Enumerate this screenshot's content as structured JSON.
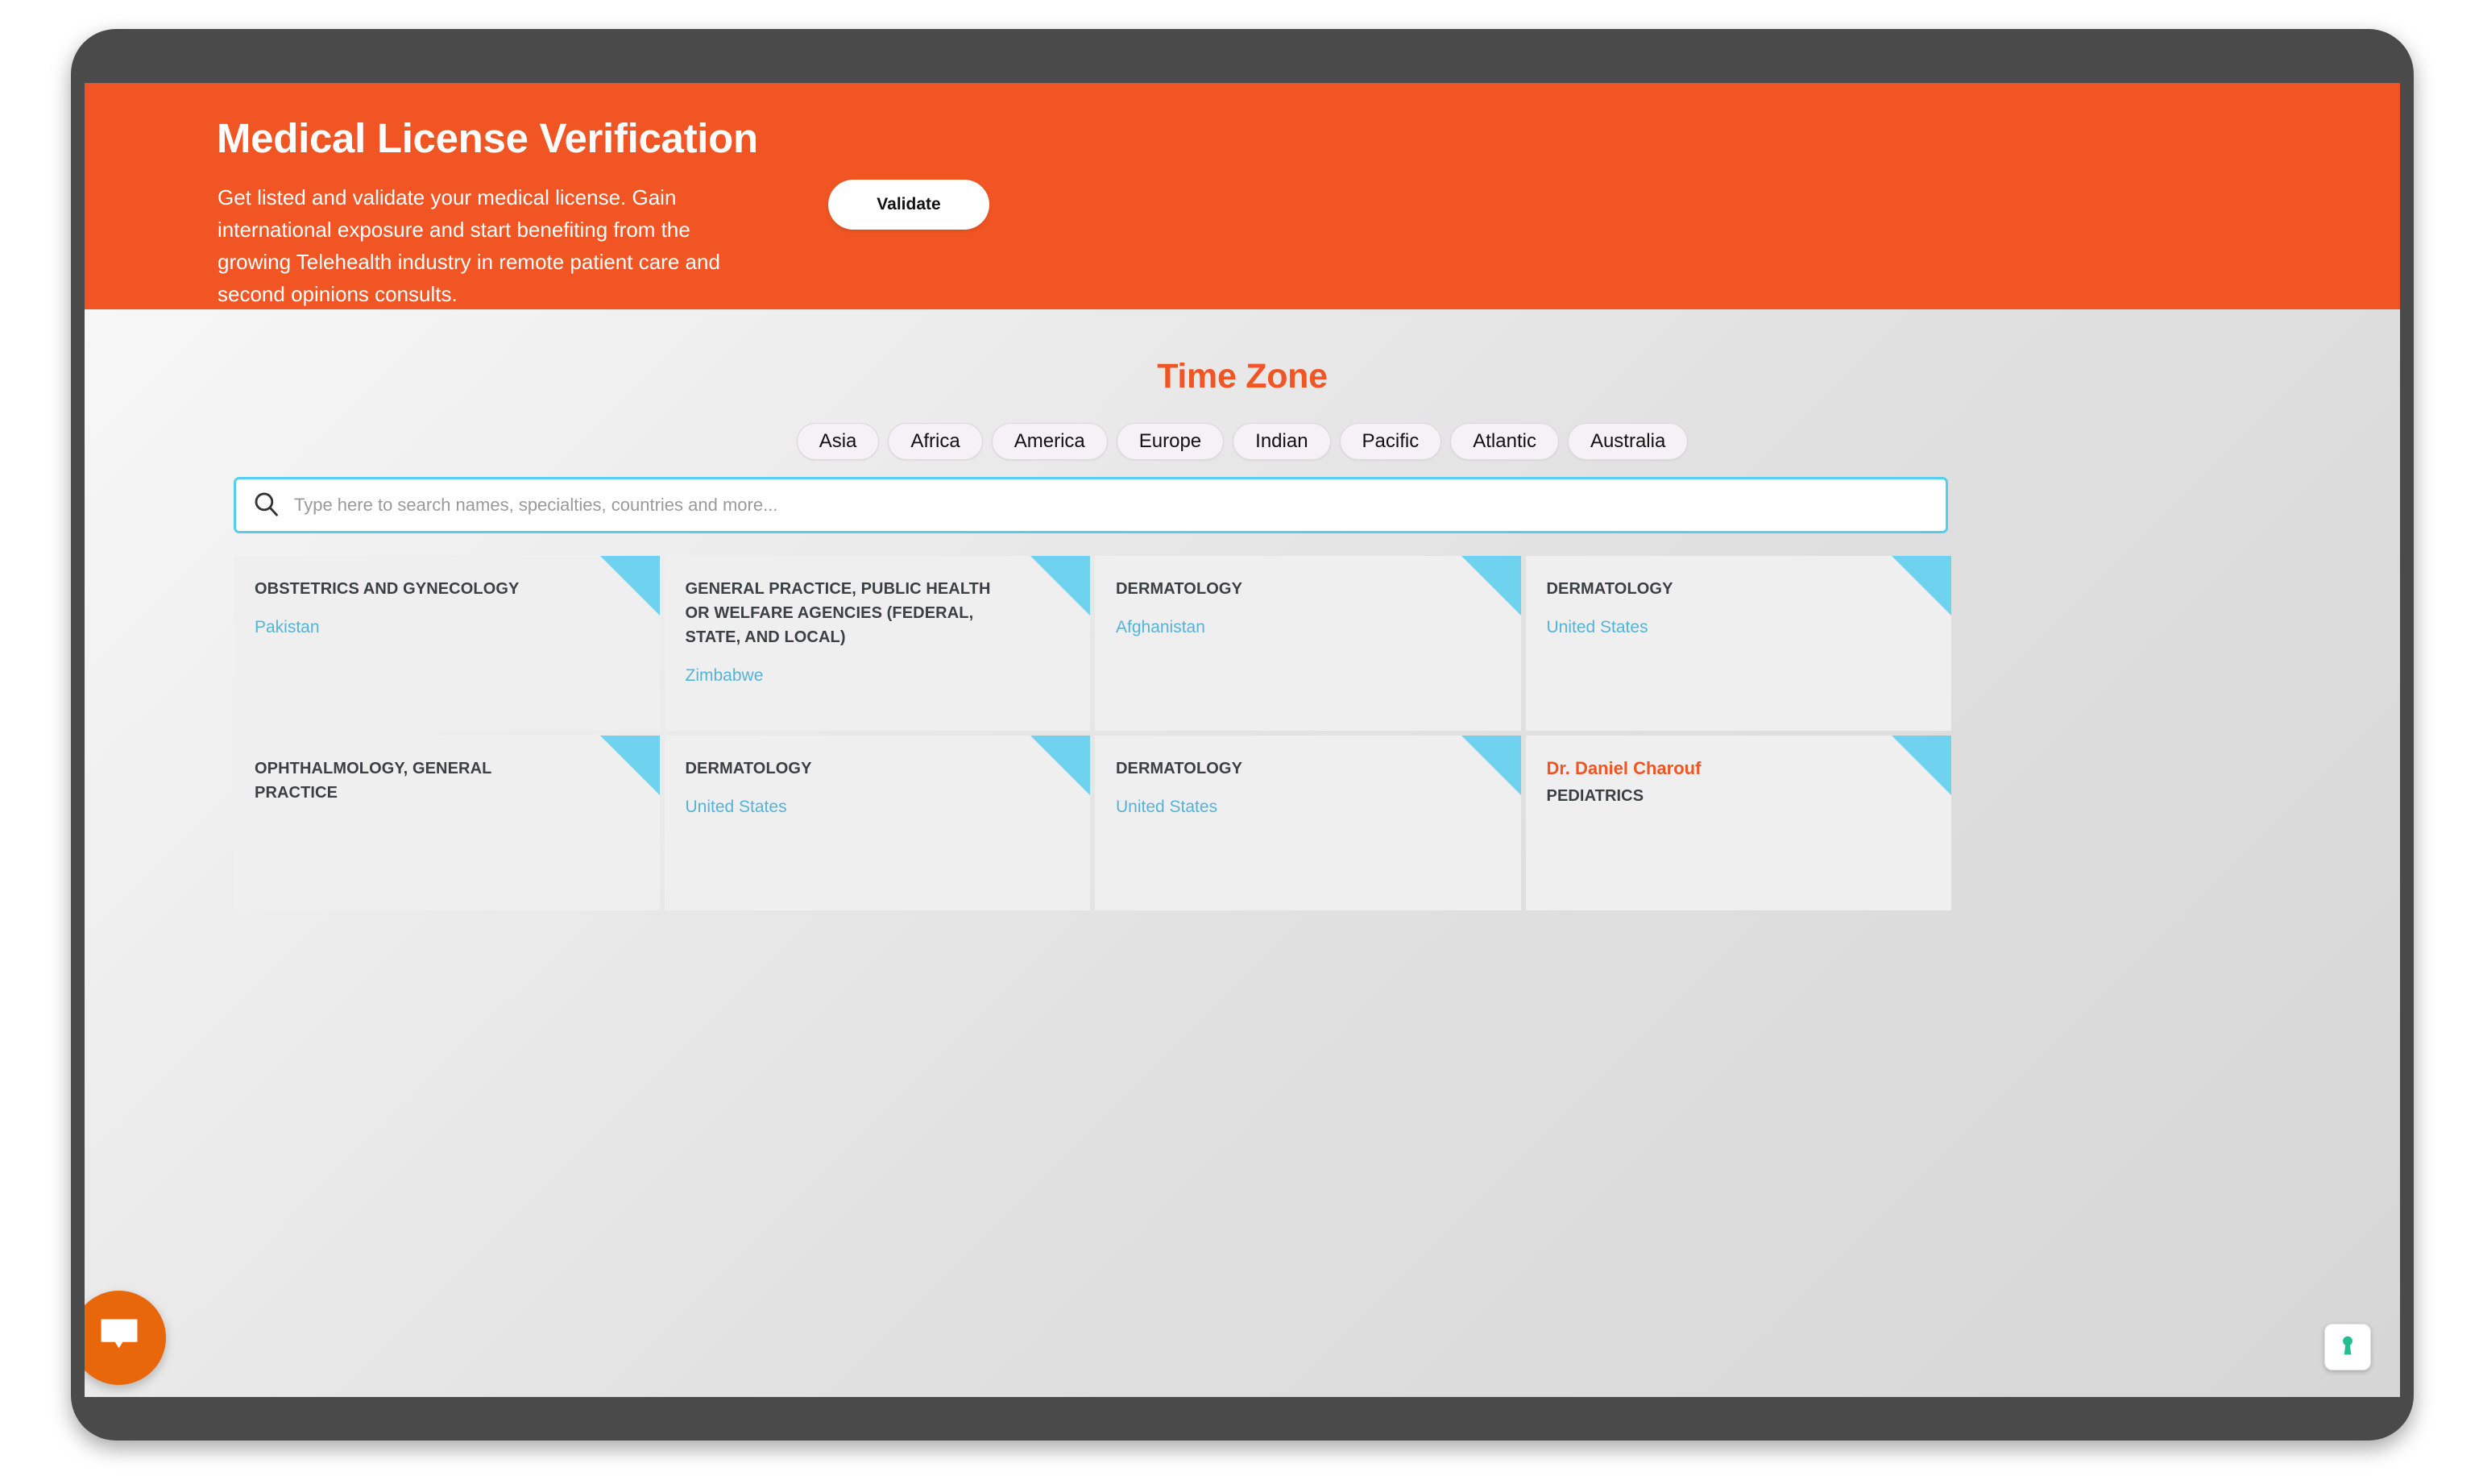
{
  "hero": {
    "title": "Medical License Verification",
    "subtitle": "Get listed and validate your medical license. Gain international exposure and start benefiting from the growing Telehealth industry in remote patient care and second opinions consults.",
    "validate_label": "Validate",
    "background_color": "#F15523",
    "text_color": "#FFFFFF"
  },
  "section": {
    "title": "Time Zone",
    "title_color": "#F15523"
  },
  "timezones": [
    {
      "label": "Asia"
    },
    {
      "label": "Africa"
    },
    {
      "label": "America"
    },
    {
      "label": "Europe"
    },
    {
      "label": "Indian"
    },
    {
      "label": "Pacific"
    },
    {
      "label": "Atlantic"
    },
    {
      "label": "Australia"
    }
  ],
  "search": {
    "value": "",
    "placeholder": "Type here to search names, specialties, countries and more...",
    "icon": "search-icon",
    "border_color": "#55CDEF"
  },
  "cards": [
    {
      "doctor": "",
      "specialty": "OBSTETRICS AND GYNECOLOGY",
      "country": "Pakistan"
    },
    {
      "doctor": "",
      "specialty": "GENERAL PRACTICE, PUBLIC HEALTH OR WELFARE AGENCIES (FEDERAL, STATE, AND LOCAL)",
      "country": "Zimbabwe"
    },
    {
      "doctor": "",
      "specialty": "DERMATOLOGY",
      "country": "Afghanistan"
    },
    {
      "doctor": "",
      "specialty": "DERMATOLOGY",
      "country": "United States"
    },
    {
      "doctor": "",
      "specialty": "OPHTHALMOLOGY, GENERAL PRACTICE",
      "country": ""
    },
    {
      "doctor": "",
      "specialty": "DERMATOLOGY",
      "country": "United States"
    },
    {
      "doctor": "",
      "specialty": "DERMATOLOGY",
      "country": "United States"
    },
    {
      "doctor": "Dr. Daniel Charouf",
      "specialty": "PEDIATRICS",
      "country": ""
    }
  ],
  "widgets": {
    "chat_icon": "chat-bubble-icon",
    "chat_color": "#E8670A",
    "privacy_icon": "keyhole-icon",
    "privacy_color": "#22BE8F"
  },
  "colors": {
    "accent_orange": "#F15523",
    "accent_cyan": "#6FD2EF",
    "card_background": "#EFEFEF",
    "country_link": "#54B3D8"
  }
}
